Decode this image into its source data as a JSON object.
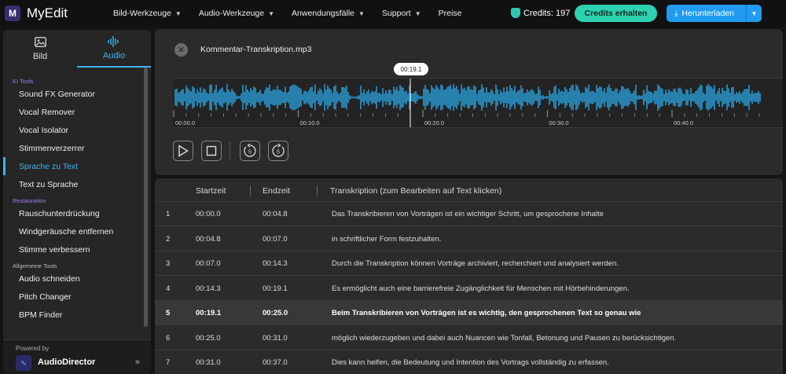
{
  "app": {
    "name": "MyEdit",
    "logo_letter": "M"
  },
  "nav": [
    {
      "label": "Bild-Werkzeuge"
    },
    {
      "label": "Audio-Werkzeuge"
    },
    {
      "label": "Anwendungsfälle"
    },
    {
      "label": "Support"
    },
    {
      "label": "Preise"
    }
  ],
  "credits": {
    "label": "Credits: 197"
  },
  "buttons": {
    "get_credits": "Credits erhalten",
    "download": "Herunterladen"
  },
  "sidebar": {
    "tabs": [
      {
        "label": "Bild"
      },
      {
        "label": "Audio"
      }
    ],
    "sections": [
      {
        "title": "KI Tools",
        "items": [
          "Sound FX Generator",
          "Vocal Remover",
          "Vocal Isolator",
          "Stimmenverzerrer",
          "Sprache zu Text",
          "Text zu Sprache"
        ]
      },
      {
        "title": "Restauration",
        "items": [
          "Rauschunterdrückung",
          "Windgeräusche entfernen",
          "Stimme verbessern"
        ]
      },
      {
        "title": "Allgemeine Tools",
        "items": [
          "Audio schneiden",
          "Pitch Changer",
          "BPM Finder"
        ]
      }
    ],
    "active_item": "Sprache zu Text",
    "powered_by": "Powered by",
    "powered_name": "AudioDirector"
  },
  "player": {
    "filename": "Kommentar-Transkription.mp3",
    "playhead_time": "00:19.1",
    "ticks": [
      "00:00.0",
      "00:10.0",
      "00:20.0",
      "00:30.0",
      "00:40.0"
    ],
    "controls": [
      {
        "icon": "play-icon"
      },
      {
        "icon": "stop-icon"
      },
      {
        "icon": "rewind-5-icon"
      },
      {
        "icon": "forward-5-icon"
      }
    ],
    "wave_color": "#2aa7e6"
  },
  "table": {
    "headers": [
      "Startzeit",
      "Endzeit",
      "Transkription (zum Bearbeiten auf Text klicken)"
    ],
    "rows": [
      {
        "n": "1",
        "start": "00:00.0",
        "end": "00:04.8",
        "text": "Das Transkribieren von Vorträgen ist ein wichtiger Schritt, um gesprochene Inhalte"
      },
      {
        "n": "2",
        "start": "00:04.8",
        "end": "00:07.0",
        "text": "in schriftlicher Form festzuhalten."
      },
      {
        "n": "3",
        "start": "00:07.0",
        "end": "00:14.3",
        "text": "Durch die Transkription können Vorträge archiviert, recherchiert und analysiert werden."
      },
      {
        "n": "4",
        "start": "00:14.3",
        "end": "00:19.1",
        "text": "Es ermöglicht auch eine barrierefreie Zugänglichkeit für Menschen mit Hörbehinderungen."
      },
      {
        "n": "5",
        "start": "00:19.1",
        "end": "00:25.0",
        "text": "Beim Transkribieren von Vorträgen ist es wichtig, den gesprochenen Text so genau wie"
      },
      {
        "n": "6",
        "start": "00:25.0",
        "end": "00:31.0",
        "text": "möglich wiederzugeben und dabei auch Nuancen wie Tonfall, Betonung und Pausen zu berücksichtigen."
      },
      {
        "n": "7",
        "start": "00:31.0",
        "end": "00:37.0",
        "text": "Dies kann helfen, die Bedeutung und Intention des Vortrags vollständig zu erfassen."
      }
    ],
    "highlighted_row": "5"
  }
}
